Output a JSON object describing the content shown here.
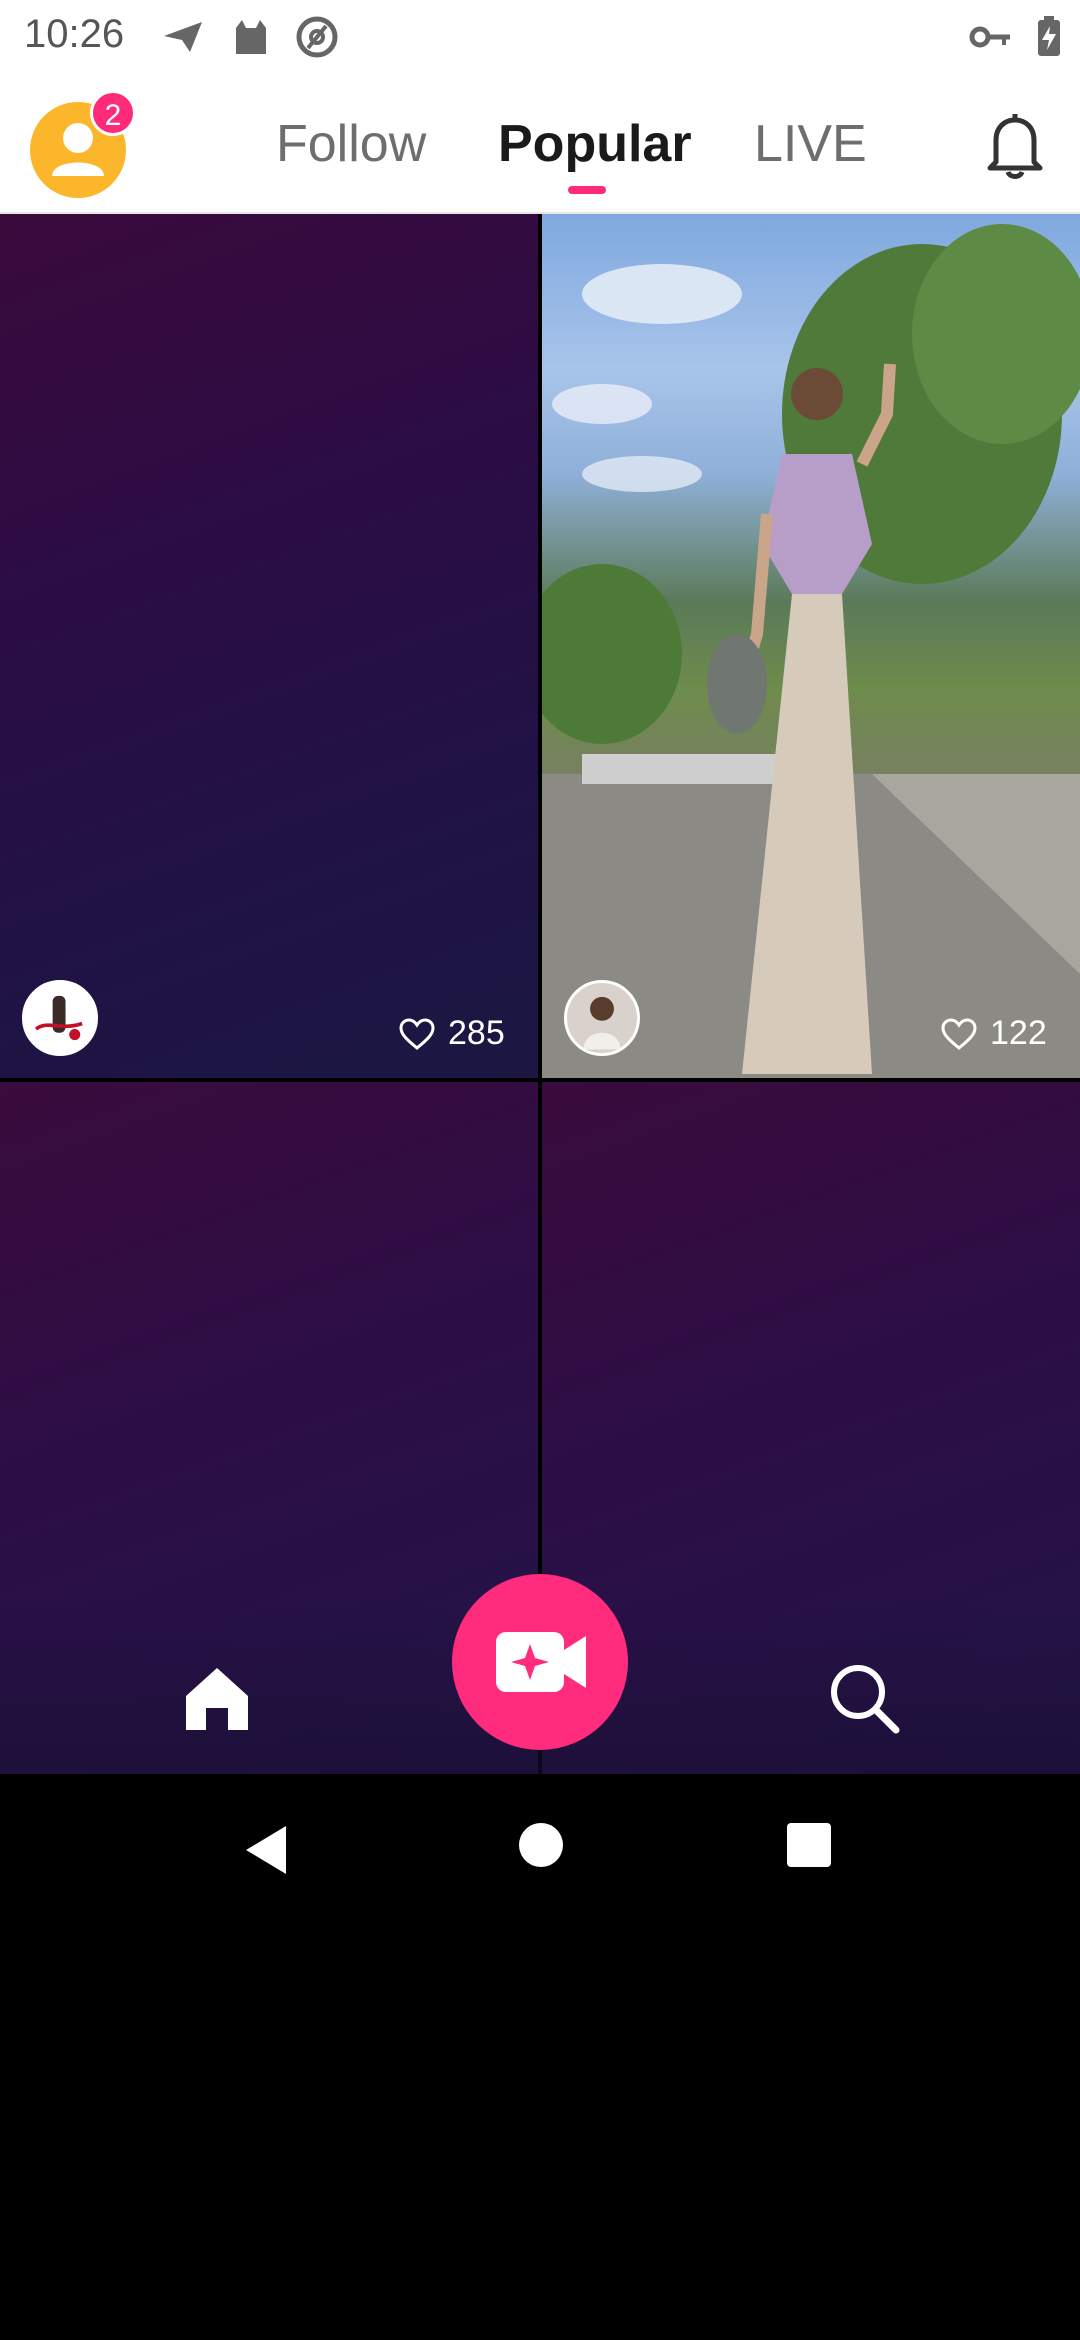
{
  "status_bar": {
    "time": "10:26",
    "left_icons": [
      "paper-plane-icon",
      "cat-icon",
      "at-sign-icon"
    ],
    "right_icons": [
      "key-icon",
      "battery-charging-icon"
    ]
  },
  "top_nav": {
    "notification_badge": "2",
    "tabs": [
      {
        "label": "Follow",
        "active": false
      },
      {
        "label": "Popular",
        "active": true
      },
      {
        "label": "LIVE",
        "active": false
      }
    ],
    "accent_color": "#ff2a7a"
  },
  "feed": {
    "tiles": [
      {
        "likes": "285",
        "thumbnail": "purple-gradient",
        "avatar": "creator-avatar-red-logo"
      },
      {
        "likes": "122",
        "thumbnail": "woman-in-long-dress-street-photo",
        "avatar": "creator-avatar-woman"
      },
      {
        "likes": "",
        "thumbnail": "purple-gradient"
      },
      {
        "likes": "",
        "thumbnail": "purple-gradient"
      }
    ]
  },
  "bottom_bar": {
    "items": [
      "home-icon",
      "record-video-icon",
      "search-icon"
    ],
    "record_button_color": "#ff2c7d"
  },
  "system_nav": {
    "buttons": [
      "back",
      "home",
      "recents"
    ]
  }
}
